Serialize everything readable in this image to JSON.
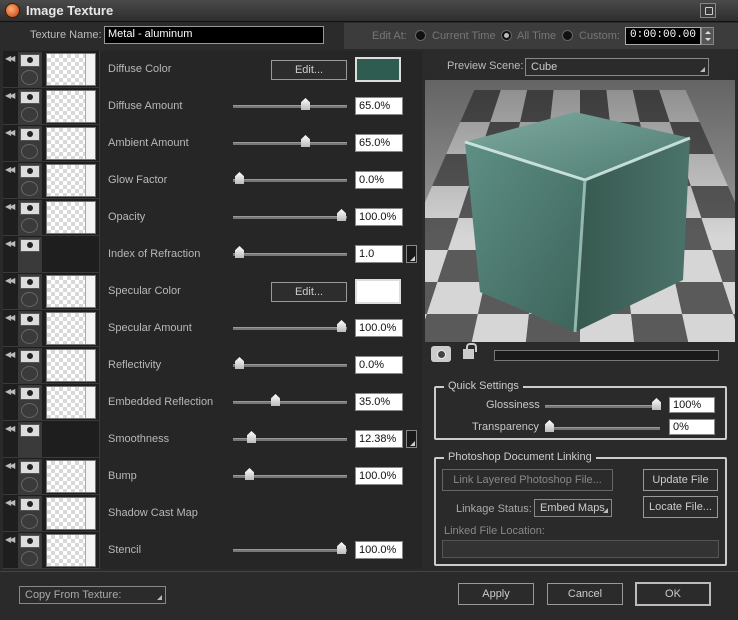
{
  "window": {
    "title": "Image Texture"
  },
  "header": {
    "texture_name_label": "Texture Name:",
    "texture_name_value": "Metal - aluminum",
    "edit_at_label": "Edit At:",
    "current_time_label": "Current Time",
    "all_time_label": "All Time",
    "custom_label": "Custom:",
    "time_value": "0:00:00.00",
    "selected_mode": "All Time"
  },
  "channels": [
    {
      "name": "Diffuse Color",
      "type": "color",
      "edit_label": "Edit...",
      "color": "#2e5c50",
      "thumb": true
    },
    {
      "name": "Diffuse Amount",
      "type": "slider",
      "value": "65.0%",
      "level": 0.65,
      "thumb": true
    },
    {
      "name": "Ambient Amount",
      "type": "slider",
      "value": "65.0%",
      "level": 0.65,
      "thumb": true
    },
    {
      "name": "Glow Factor",
      "type": "slider",
      "value": "0.0%",
      "level": 0.0,
      "thumb": true
    },
    {
      "name": "Opacity",
      "type": "slider",
      "value": "100.0%",
      "level": 1.0,
      "thumb": true
    },
    {
      "name": "Index of Refraction",
      "type": "slider",
      "value": "1.0",
      "level": 0.0,
      "thumb": false,
      "corner": true
    },
    {
      "name": "Specular Color",
      "type": "color",
      "edit_label": "Edit...",
      "color": "#ffffff",
      "thumb": true
    },
    {
      "name": "Specular Amount",
      "type": "slider",
      "value": "100.0%",
      "level": 1.0,
      "thumb": true
    },
    {
      "name": "Reflectivity",
      "type": "slider",
      "value": "0.0%",
      "level": 0.0,
      "thumb": true
    },
    {
      "name": "Embedded Reflection",
      "type": "slider",
      "value": "35.0%",
      "level": 0.35,
      "thumb": true
    },
    {
      "name": "Smoothness",
      "type": "slider",
      "value": "12.38%",
      "level": 0.12,
      "thumb": false,
      "corner": true
    },
    {
      "name": "Bump",
      "type": "slider",
      "value": "100.0%",
      "level": 0.1,
      "thumb": true
    },
    {
      "name": "Shadow Cast Map",
      "type": "none",
      "thumb": true
    },
    {
      "name": "Stencil",
      "type": "slider",
      "value": "100.0%",
      "level": 1.0,
      "thumb": true
    }
  ],
  "preview": {
    "label": "Preview Scene:",
    "scene": "Cube",
    "cube_color": "#4d7d73"
  },
  "quick_settings": {
    "title": "Quick Settings",
    "glossiness_label": "Glossiness",
    "glossiness_value": "100%",
    "glossiness_level": 1.0,
    "transparency_label": "Transparency",
    "transparency_value": "0%",
    "transparency_level": 0.0
  },
  "photoshop": {
    "title": "Photoshop Document Linking",
    "link_button": "Link Layered Photoshop File...",
    "update_button": "Update File",
    "linkage_status_label": "Linkage Status:",
    "linkage_status_value": "Embed Maps",
    "locate_button": "Locate File...",
    "linked_file_label": "Linked File Location:"
  },
  "footer": {
    "copy_from": "Copy From Texture:",
    "apply": "Apply",
    "cancel": "Cancel",
    "ok": "OK"
  }
}
